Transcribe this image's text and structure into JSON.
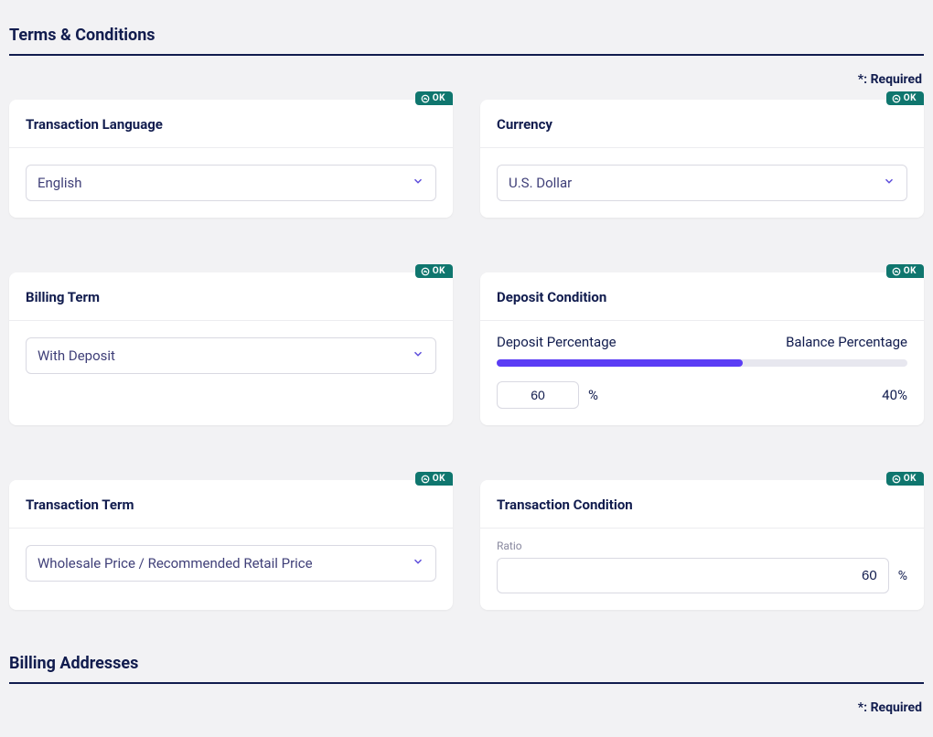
{
  "sections": {
    "terms": {
      "title": "Terms & Conditions",
      "required_note": "*: Required"
    },
    "billing_addresses": {
      "title": "Billing Addresses",
      "required_note": "*: Required"
    }
  },
  "badge": {
    "ok": "OK"
  },
  "cards": {
    "transaction_language": {
      "title": "Transaction Language",
      "value": "English"
    },
    "currency": {
      "title": "Currency",
      "value": "U.S. Dollar"
    },
    "billing_term": {
      "title": "Billing Term",
      "value": "With Deposit"
    },
    "deposit_condition": {
      "title": "Deposit Condition",
      "deposit_label": "Deposit Percentage",
      "balance_label": "Balance Percentage",
      "deposit_value": "60",
      "balance_value": "40%",
      "unit": "%",
      "slider_percent": 60
    },
    "transaction_term": {
      "title": "Transaction Term",
      "value": "Wholesale Price / Recommended Retail Price"
    },
    "transaction_condition": {
      "title": "Transaction Condition",
      "ratio_label": "Ratio",
      "ratio_value": "60",
      "unit": "%"
    }
  }
}
